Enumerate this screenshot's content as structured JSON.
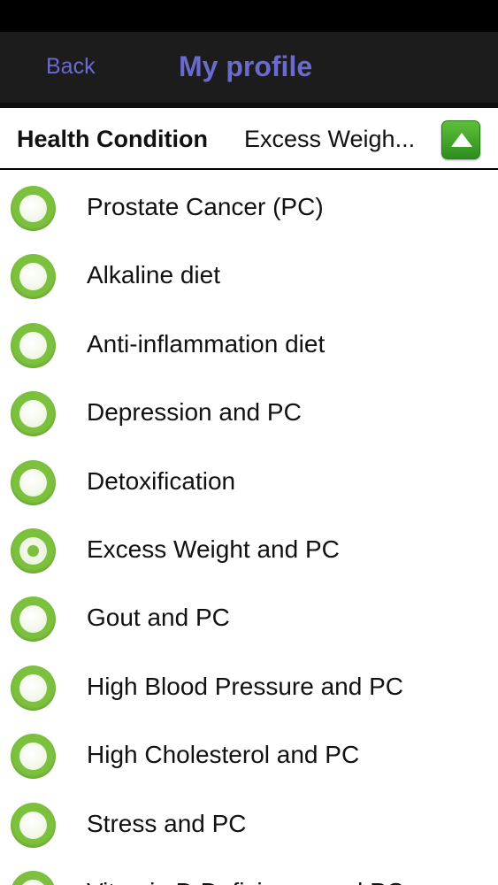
{
  "nav": {
    "back_label": "Back",
    "title": "My profile"
  },
  "condition": {
    "label": "Health Condition",
    "value": "Excess Weigh...",
    "toggle_icon": "triangle-up-icon"
  },
  "options": [
    {
      "label": "Prostate Cancer (PC)",
      "selected": false
    },
    {
      "label": "Alkaline diet",
      "selected": false
    },
    {
      "label": "Anti-inflammation diet",
      "selected": false
    },
    {
      "label": "Depression and PC",
      "selected": false
    },
    {
      "label": "Detoxification",
      "selected": false
    },
    {
      "label": "Excess Weight and PC",
      "selected": true
    },
    {
      "label": "Gout and PC",
      "selected": false
    },
    {
      "label": "High Blood Pressure and PC",
      "selected": false
    },
    {
      "label": "High Cholesterol and PC",
      "selected": false
    },
    {
      "label": "Stress and PC",
      "selected": false
    },
    {
      "label": "Vitamin D Deficiency and PC",
      "selected": false
    }
  ],
  "colors": {
    "accent": "#6a6ad0",
    "radio_green": "#7cc13d",
    "toggle_green": "#3fa12a"
  }
}
